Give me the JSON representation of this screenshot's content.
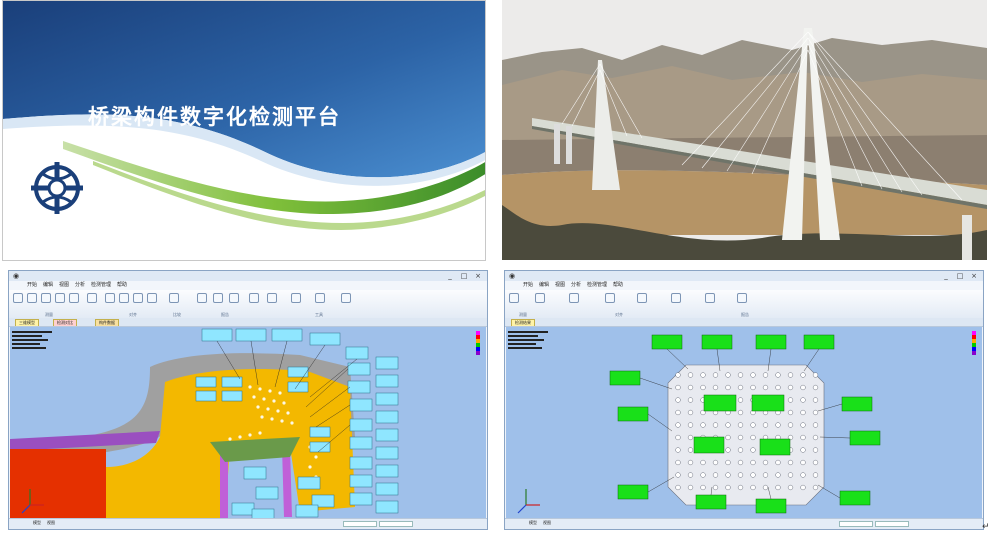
{
  "slide": {
    "title": "桥梁构件数字化检测平台"
  },
  "photo": {
    "subject": "cable-stayed-bridge-photo"
  },
  "left_app": {
    "title_icon": "app-icon",
    "window_controls": [
      "_",
      "□",
      "×"
    ],
    "menu": [
      "开始",
      "编辑",
      "视图",
      "分析",
      "检测管理",
      "帮助"
    ],
    "ribbon_groups": [
      "测量",
      "对齐",
      "比较",
      "报告",
      "工具"
    ],
    "tabs": [
      "三维模型",
      "检测对比",
      "构件数据"
    ],
    "status_tabs": [
      "模型",
      "视图"
    ]
  },
  "right_app": {
    "title_icon": "app-icon",
    "window_controls": [
      "_",
      "□",
      "×"
    ],
    "menu": [
      "开始",
      "编辑",
      "视图",
      "分析",
      "检测管理",
      "帮助"
    ],
    "ribbon_groups": [
      "测量",
      "对齐",
      "报告"
    ],
    "tabs": [
      "检测结果"
    ],
    "status_tabs": [
      "模型",
      "视图"
    ]
  },
  "colors": {
    "slide_blue_dark": "#1a3f7a",
    "slide_blue_mid": "#2f6fb4",
    "slide_green": "#7fbf3a",
    "viewport_bg": "#9fc0ea",
    "part_yellow": "#f3b800",
    "part_red": "#e53000",
    "part_purple": "#9a4fc0",
    "part_gray": "#a0a0a0",
    "label_cyan": "#8fe6ff",
    "label_green": "#19e019",
    "plate_white": "#e8eaf0"
  }
}
